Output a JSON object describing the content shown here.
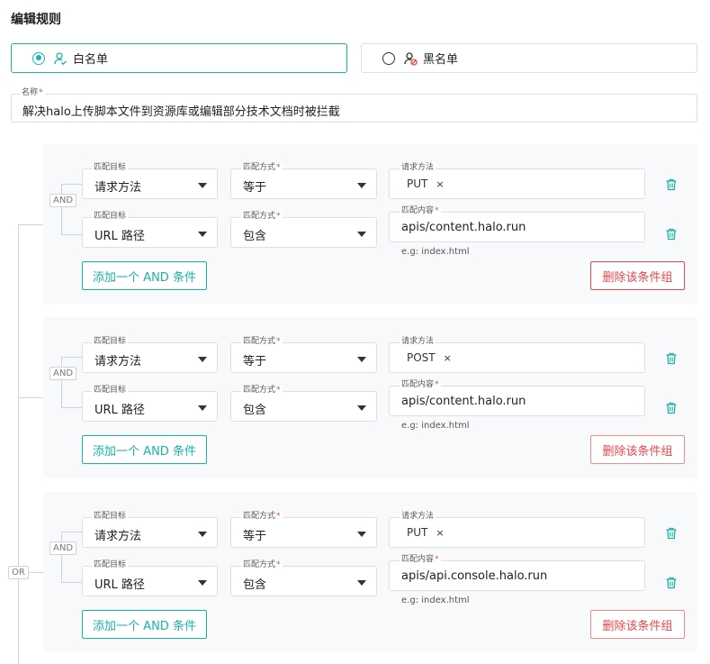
{
  "page": {
    "title": "编辑规则"
  },
  "list_type": {
    "whitelist_label": "白名单",
    "blacklist_label": "黑名单",
    "selected": "whitelist"
  },
  "name_field": {
    "label": "名称",
    "required_mark": "*",
    "value": "解决halo上传脚本文件到资源库或编辑部分技术文档时被拦截"
  },
  "logic": {
    "or_label": "OR",
    "and_label": "AND"
  },
  "labels": {
    "match_target": "匹配目标",
    "match_mode": "匹配方式",
    "request_method": "请求方法",
    "match_content": "匹配内容",
    "required_mark": "*",
    "tag_remove": "×"
  },
  "groups": [
    {
      "conditions": [
        {
          "target": "请求方法",
          "mode": "等于",
          "kind": "method",
          "value": "PUT"
        },
        {
          "target": "URL 路径",
          "mode": "包含",
          "kind": "content",
          "value": "apis/content.halo.run",
          "hint": "e.g: index.html"
        }
      ],
      "add_label": "添加一个 AND 条件",
      "delete_label": "删除该条件组"
    },
    {
      "conditions": [
        {
          "target": "请求方法",
          "mode": "等于",
          "kind": "method",
          "value": "POST"
        },
        {
          "target": "URL 路径",
          "mode": "包含",
          "kind": "content",
          "value": "apis/content.halo.run",
          "hint": "e.g: index.html"
        }
      ],
      "add_label": "添加一个 AND 条件",
      "delete_label": "删除该条件组"
    },
    {
      "conditions": [
        {
          "target": "请求方法",
          "mode": "等于",
          "kind": "method",
          "value": "PUT"
        },
        {
          "target": "URL 路径",
          "mode": "包含",
          "kind": "content",
          "value": "apis/api.console.halo.run",
          "hint": "e.g: index.html"
        }
      ],
      "add_label": "添加一个 AND 条件",
      "delete_label": "删除该条件组"
    }
  ],
  "colors": {
    "accent": "#1ab3a8",
    "danger": "#e5484d",
    "group_bg": "#f8f9fb"
  }
}
